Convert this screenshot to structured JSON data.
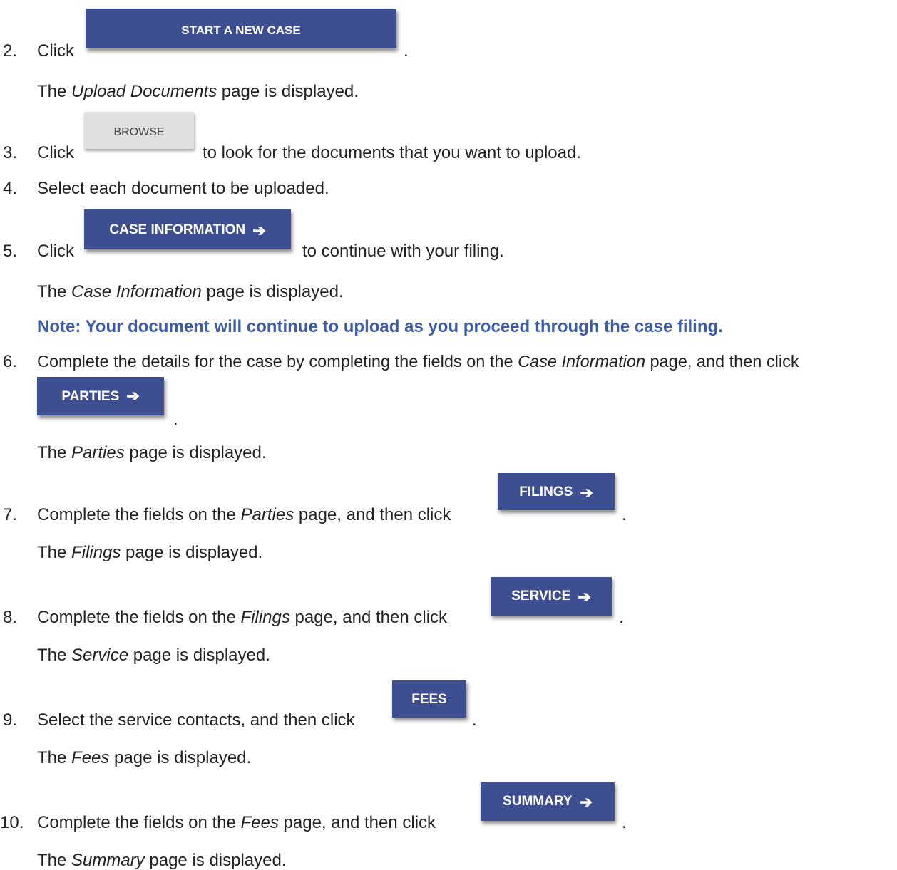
{
  "steps": [
    {
      "num": "2.",
      "prefix": "Click",
      "suffix": ".",
      "button": "START A NEW CASE",
      "result_pre": "The ",
      "result_em": "Upload Documents",
      "result_post": " page is displayed."
    },
    {
      "num": "3.",
      "prefix": "Click",
      "button": "BROWSE",
      "suffix": "to look for the documents that you want to upload."
    },
    {
      "num": "4.",
      "text": "Select each document to be uploaded."
    },
    {
      "num": "5.",
      "prefix": "Click",
      "button": "CASE INFORMATION",
      "suffix": "to continue with your filing.",
      "result_pre": "The ",
      "result_em": "Case Information",
      "result_post": " page is displayed."
    },
    {
      "num": "6.",
      "text_pre": "Complete the details for the case by completing the fields on the ",
      "text_em": "Case Information",
      "text_post": " page, and then click",
      "button": "PARTIES",
      "suffix": ".",
      "result_pre": "The ",
      "result_em": "Parties",
      "result_post": " page is displayed."
    },
    {
      "num": "7.",
      "text_pre": "Complete the fields on the ",
      "text_em": "Parties",
      "text_post": " page, and then click",
      "button": "FILINGS",
      "suffix": ".",
      "result_pre": "The ",
      "result_em": "Filings",
      "result_post": " page is displayed."
    },
    {
      "num": "8.",
      "text_pre": "Complete the fields on the ",
      "text_em": "Filings",
      "text_post": " page, and then click",
      "button": "SERVICE",
      "suffix": ".",
      "result_pre": "The ",
      "result_em": "Service",
      "result_post": " page is displayed."
    },
    {
      "num": "9.",
      "text": "Select the service contacts, and then click",
      "button": "FEES",
      "suffix": ".",
      "result_pre": "The ",
      "result_em": "Fees",
      "result_post": " page is displayed."
    },
    {
      "num": "10.",
      "text_pre": "Complete the fields on the ",
      "text_em": "Fees",
      "text_post": " page, and then click",
      "button": "SUMMARY",
      "suffix": ".",
      "result_pre": "The ",
      "result_em": "Summary",
      "result_post": " page is displayed."
    }
  ],
  "note": "Note: Your document will continue to upload as you proceed through the case filing.",
  "arrow_glyph": "➔",
  "colors": {
    "button": "#3d4f91",
    "button_gray": "#e0e0e0",
    "note": "#3d5ea6",
    "text": "#222222"
  }
}
